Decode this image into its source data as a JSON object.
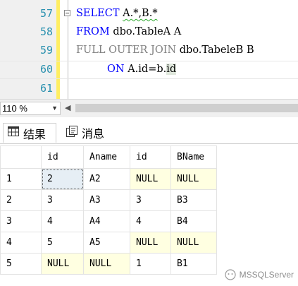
{
  "editor": {
    "lines": [
      {
        "num": "57"
      },
      {
        "num": "58"
      },
      {
        "num": "59"
      },
      {
        "num": "60"
      },
      {
        "num": "61"
      }
    ],
    "tokens": {
      "select_kw": "SELECT",
      "select_cols": "A.*,B.*",
      "from_kw": "FROM",
      "from_table": "dbo.TableA A",
      "join_kw": "FULL OUTER JOIN",
      "join_table": "dbo.TabeleB B",
      "on_kw": "ON",
      "on_expr_a": "A.id=b.",
      "on_expr_b": "id"
    }
  },
  "status": {
    "zoom": "110 %"
  },
  "tabs": {
    "results": "结果",
    "messages": "消息"
  },
  "grid": {
    "headers": [
      "id",
      "Aname",
      "id",
      "BName"
    ],
    "rows": [
      {
        "n": "1",
        "cells": [
          "2",
          "A2",
          "NULL",
          "NULL"
        ]
      },
      {
        "n": "2",
        "cells": [
          "3",
          "A3",
          "3",
          "B3"
        ]
      },
      {
        "n": "3",
        "cells": [
          "4",
          "A4",
          "4",
          "B4"
        ]
      },
      {
        "n": "4",
        "cells": [
          "5",
          "A5",
          "NULL",
          "NULL"
        ]
      },
      {
        "n": "5",
        "cells": [
          "NULL",
          "NULL",
          "1",
          "B1"
        ]
      }
    ]
  },
  "watermark": "MSSQLServer",
  "colors": {
    "keyword": "#0000ff",
    "gray": "#808080",
    "line_number": "#2b91af",
    "null_cell": "#ffffe1",
    "change_bar": "#ffee62"
  }
}
